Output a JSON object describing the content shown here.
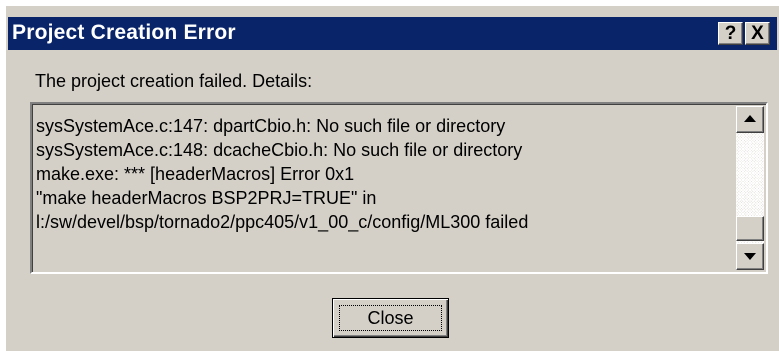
{
  "window": {
    "title": "Project Creation Error",
    "help_glyph": "?",
    "close_glyph": "X"
  },
  "message": {
    "label": "The project creation failed. Details:",
    "details_lines": [
      "sysSystemAce.c:147: dpartCbio.h: No such file or directory",
      "sysSystemAce.c:148: dcacheCbio.h: No such file or directory",
      "make.exe: *** [headerMacros] Error 0x1",
      "\"make headerMacros BSP2PRJ=TRUE\" in",
      "l:/sw/devel/bsp/tornado2/ppc405/v1_00_c/config/ML300 failed"
    ]
  },
  "buttons": {
    "close_label": "Close"
  },
  "icons": {
    "help": "help-icon",
    "close": "close-icon",
    "scroll_up": "arrow-up-icon",
    "scroll_down": "arrow-down-icon"
  },
  "colors": {
    "titlebar": "#0a246a",
    "title_text": "#ffffff",
    "dialog_face": "#d4d0c8"
  }
}
